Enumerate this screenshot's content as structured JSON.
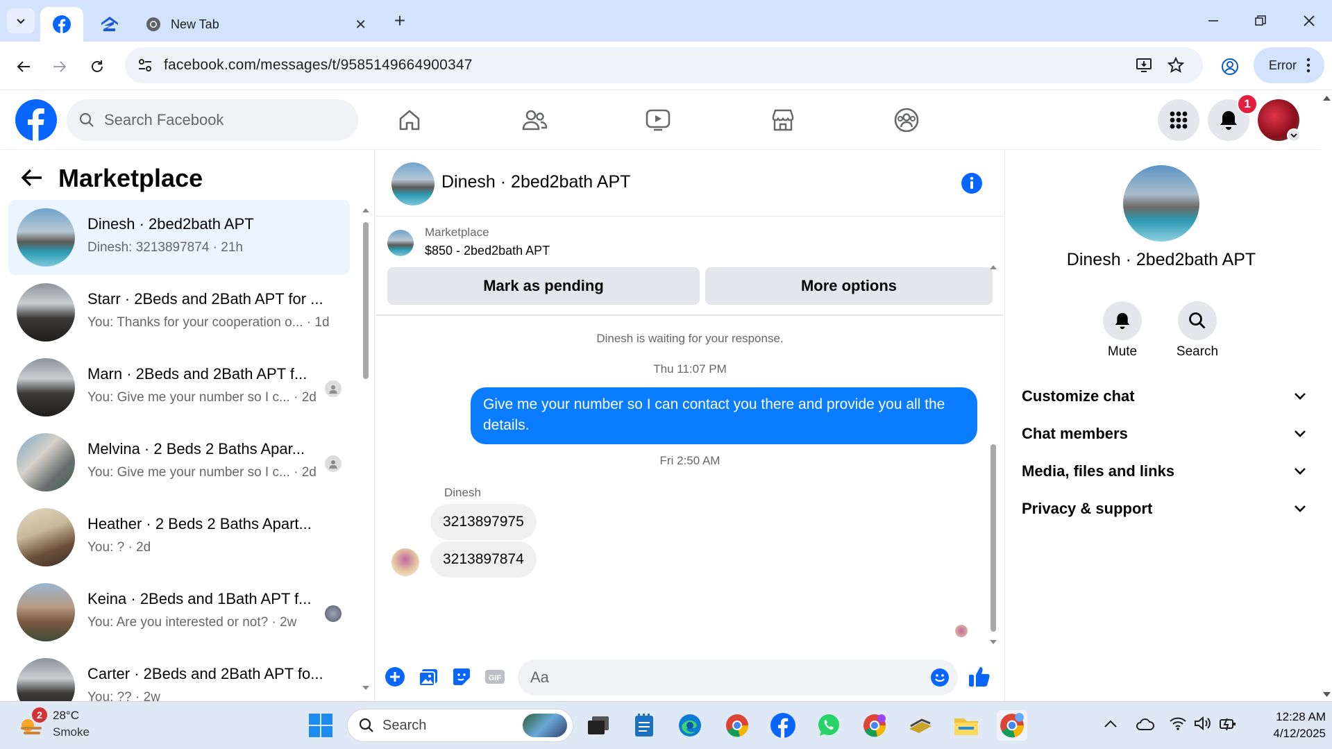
{
  "browser": {
    "tabs": [
      {
        "label": "",
        "icon": "facebook-icon"
      },
      {
        "label": "",
        "icon": "zillow-icon"
      },
      {
        "label": "New Tab",
        "icon": "chrome-icon"
      }
    ],
    "url": "facebook.com/messages/t/9585149664900347",
    "error_label": "Error"
  },
  "fb": {
    "search_placeholder": "Search Facebook",
    "notification_count": "1"
  },
  "left": {
    "title": "Marketplace",
    "conversations": [
      {
        "title": "Dinesh · 2bed2bath APT",
        "snippet": "Dinesh: 3213897874 · 21h",
        "active": true
      },
      {
        "title": "Starr · 2Beds and 2Bath APT for ...",
        "snippet": "You: Thanks for your cooperation o... · 1d"
      },
      {
        "title": "Marn · 2Beds and 2Bath APT f...",
        "snippet": "You: Give me your number so I c... · 2d"
      },
      {
        "title": "Melvina · 2 Beds 2 Baths Apar...",
        "snippet": "You: Give me your number so I c... · 2d"
      },
      {
        "title": "Heather · 2 Beds 2 Baths Apart...",
        "snippet": "You: ? · 2d"
      },
      {
        "title": "Keina · 2Beds and 1Bath APT f...",
        "snippet": "You: Are you interested or not? · 2w"
      },
      {
        "title": "Carter · 2Beds and 2Bath APT fo...",
        "snippet": "You: ?? · 2w"
      }
    ]
  },
  "chat": {
    "name": "Dinesh · 2bed2bath APT",
    "listing_label": "Marketplace",
    "listing_title": "$850 - 2bed2bath APT",
    "mark_pending": "Mark as pending",
    "more_options": "More options",
    "waiting_note": "Dinesh is waiting for your response.",
    "time1": "Thu 11:07 PM",
    "outgoing": "Give me your number so I can contact you there and provide you all the details.",
    "time2": "Fri 2:50 AM",
    "sender": "Dinesh",
    "incoming": [
      "3213897975",
      "3213897874"
    ],
    "composer_placeholder": "Aa"
  },
  "right": {
    "name": "Dinesh · 2bed2bath APT",
    "mute": "Mute",
    "search": "Search",
    "sections": [
      "Customize chat",
      "Chat members",
      "Media, files and links",
      "Privacy & support"
    ]
  },
  "taskbar": {
    "weather_badge": "2",
    "temp": "28°C",
    "condition": "Smoke",
    "search": "Search",
    "time": "12:28 AM",
    "date": "4/12/2025"
  },
  "colors": {
    "fb_blue": "#0866ff",
    "messenger_blue": "#0a7cff",
    "chrome_tabbar": "#d3e3fd",
    "active_convo": "#ebf5ff"
  }
}
